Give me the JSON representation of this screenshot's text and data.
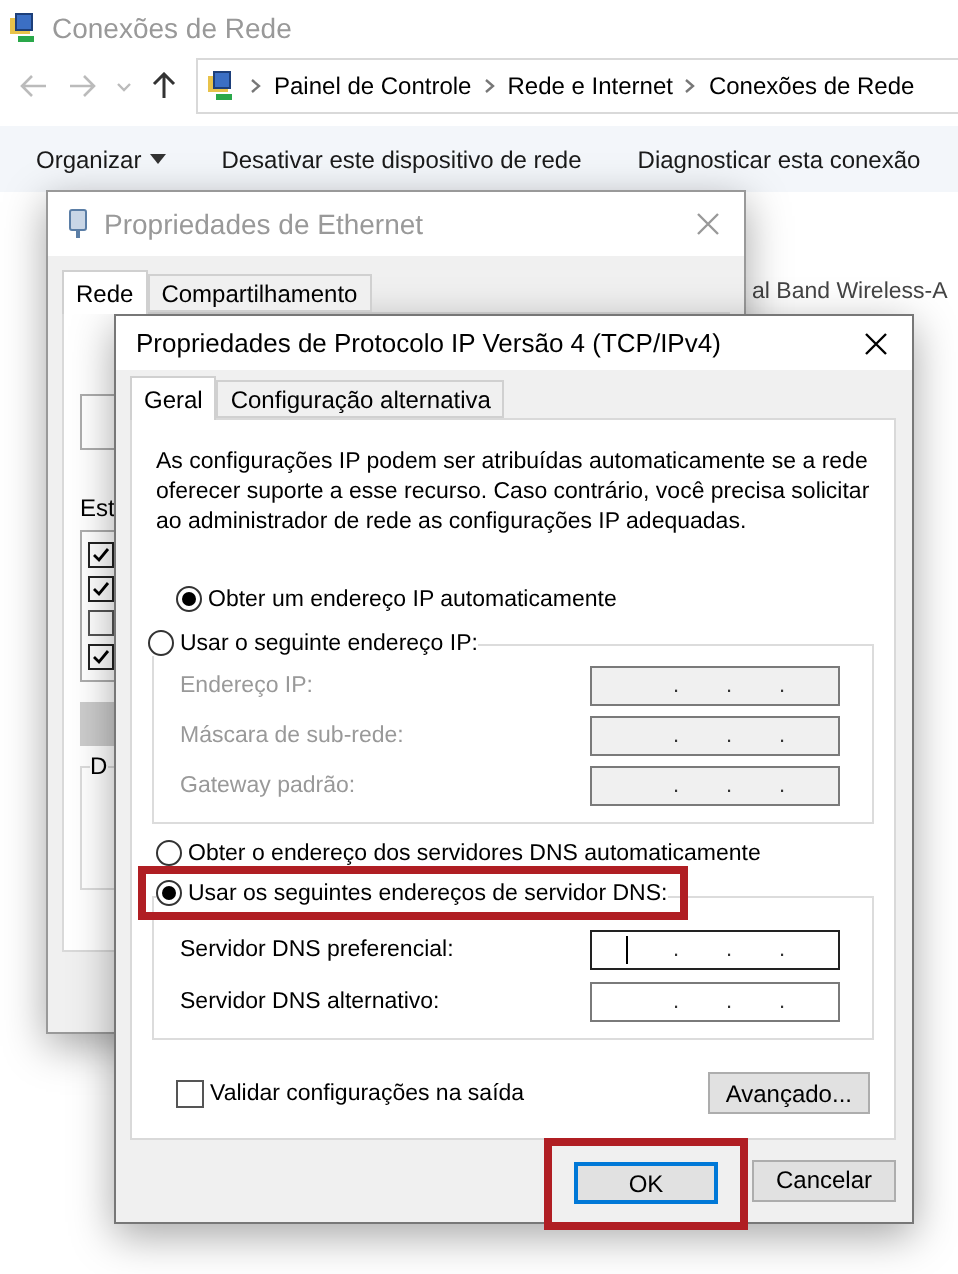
{
  "explorer": {
    "title": "Conexões de Rede",
    "breadcrumb": [
      "Painel de Controle",
      "Rede e Internet",
      "Conexões de Rede"
    ],
    "toolbar": [
      {
        "label": "Organizar",
        "dropdown": true
      },
      {
        "label": "Desativar este dispositivo de rede",
        "dropdown": false
      },
      {
        "label": "Diagnosticar esta conexão",
        "dropdown": false
      }
    ],
    "connection_label": "al Band Wireless-A"
  },
  "ethernet_window": {
    "title": "Propriedades de Ethernet",
    "tabs": [
      {
        "label": "Rede",
        "selected": true
      },
      {
        "label": "Compartilhamento",
        "selected": false
      }
    ],
    "fragments": [
      "Est",
      "D"
    ],
    "components": [
      {
        "checked": true
      },
      {
        "checked": true
      },
      {
        "checked": false
      },
      {
        "checked": true
      }
    ]
  },
  "ipv4_dialog": {
    "title": "Propriedades de Protocolo IP Versão 4 (TCP/IPv4)",
    "tabs": [
      {
        "label": "Geral",
        "selected": true
      },
      {
        "label": "Configuração alternativa",
        "selected": false
      }
    ],
    "description": "As configurações IP podem ser atribuídas automaticamente se a rede oferecer suporte a esse recurso. Caso contrário, você precisa solicitar ao administrador de rede as configurações IP adequadas.",
    "ip_mode": [
      {
        "label": "Obter um endereço IP automaticamente",
        "selected": true
      },
      {
        "label": "Usar o seguinte endereço IP:",
        "selected": false
      }
    ],
    "ip_fields": [
      {
        "label": "Endereço IP:",
        "disabled": true,
        "focused": false
      },
      {
        "label": "Máscara de sub-rede:",
        "disabled": true,
        "focused": false
      },
      {
        "label": "Gateway padrão:",
        "disabled": true,
        "focused": false
      }
    ],
    "dns_mode": [
      {
        "label": "Obter o endereço dos servidores DNS automaticamente",
        "selected": false,
        "highlighted": false
      },
      {
        "label": "Usar os seguintes endereços de servidor DNS:",
        "selected": true,
        "highlighted": true
      }
    ],
    "dns_fields": [
      {
        "label": "Servidor DNS preferencial:",
        "disabled": false,
        "focused": true
      },
      {
        "label": "Servidor DNS alternativo:",
        "disabled": false,
        "focused": false
      }
    ],
    "ip_separator": ".",
    "validate": {
      "label": "Validar configurações na saída",
      "checked": false
    },
    "advanced_button": "Avançado...",
    "buttons": [
      {
        "label": "OK",
        "default": true,
        "highlighted": true
      },
      {
        "label": "Cancelar",
        "default": false,
        "highlighted": false
      }
    ]
  }
}
